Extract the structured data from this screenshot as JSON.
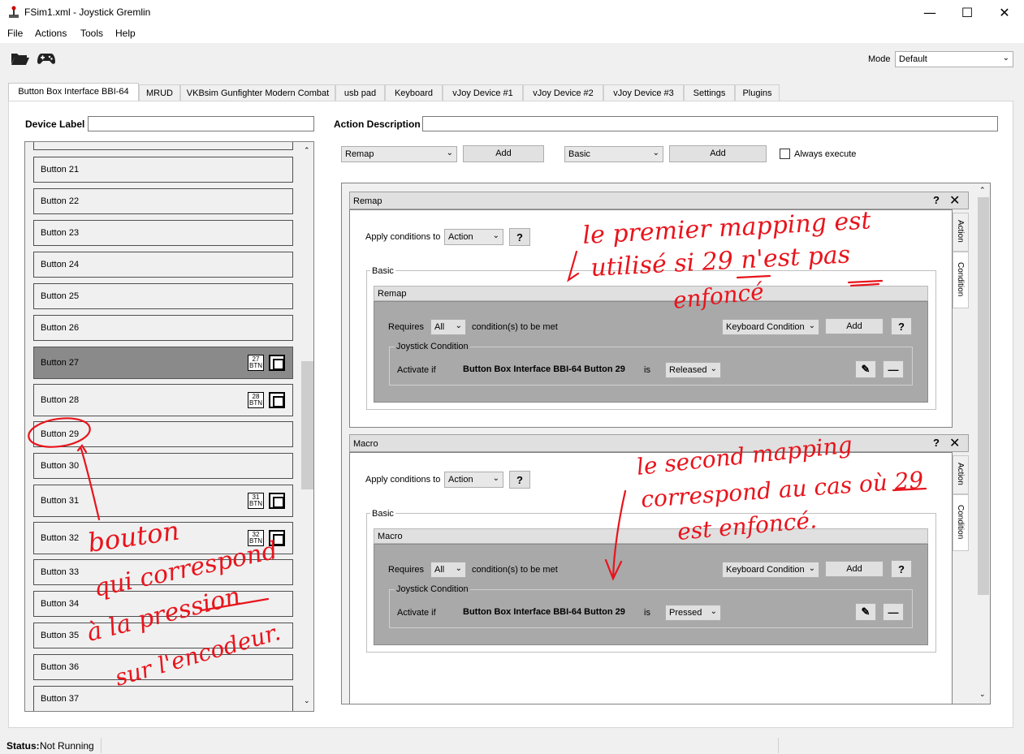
{
  "window": {
    "title": "FSim1.xml - Joystick Gremlin"
  },
  "menu": [
    "File",
    "Actions",
    "Tools",
    "Help"
  ],
  "toolbar": {
    "mode_label": "Mode",
    "mode_value": "Default"
  },
  "tabs": [
    "Button Box Interface BBI-64",
    "MRUD",
    "VKBsim Gunfighter Modern Combat",
    "usb pad",
    "Keyboard",
    "vJoy Device #1",
    "vJoy Device #2",
    "vJoy Device #3",
    "Settings",
    "Plugins"
  ],
  "left": {
    "device_label": "Device Label",
    "device_label_value": "",
    "buttons": [
      {
        "label": "Button 21",
        "badge": ""
      },
      {
        "label": "Button 22",
        "badge": ""
      },
      {
        "label": "Button 23",
        "badge": ""
      },
      {
        "label": "Button 24",
        "badge": ""
      },
      {
        "label": "Button 25",
        "badge": ""
      },
      {
        "label": "Button 26",
        "badge": ""
      },
      {
        "label": "Button 27",
        "badge": "27"
      },
      {
        "label": "Button 28",
        "badge": "28"
      },
      {
        "label": "Button 29",
        "badge": ""
      },
      {
        "label": "Button 30",
        "badge": ""
      },
      {
        "label": "Button 31",
        "badge": "31"
      },
      {
        "label": "Button 32",
        "badge": "32"
      },
      {
        "label": "Button 33",
        "badge": ""
      },
      {
        "label": "Button 34",
        "badge": ""
      },
      {
        "label": "Button 35",
        "badge": ""
      },
      {
        "label": "Button 36",
        "badge": ""
      },
      {
        "label": "Button 37",
        "badge": ""
      }
    ],
    "badge_sub": "BTN"
  },
  "right": {
    "action_description_label": "Action Description",
    "action_description_value": "",
    "action_combo": "Remap",
    "add_label": "Add",
    "container_combo": "Basic",
    "always_execute": "Always execute",
    "remap_panel": {
      "title": "Remap",
      "apply_label": "Apply conditions to",
      "apply_value": "Action",
      "help": "?",
      "basic_label": "Basic",
      "inner_header": "Remap",
      "requires": "Requires",
      "requires_value": "All",
      "conditions_met": "condition(s) to be met",
      "cond_type": "Keyboard Condition",
      "add": "Add",
      "joy_cond_label": "Joystick Condition",
      "activate_if": "Activate if",
      "input_name": "Button Box Interface BBI-64 Button 29",
      "is": "is",
      "state": "Released",
      "side_tabs": [
        "Action",
        "Condition"
      ]
    },
    "macro_panel": {
      "title": "Macro",
      "apply_label": "Apply conditions to",
      "apply_value": "Action",
      "help": "?",
      "basic_label": "Basic",
      "inner_header": "Macro",
      "requires": "Requires",
      "requires_value": "All",
      "conditions_met": "condition(s) to be met",
      "cond_type": "Keyboard Condition",
      "add": "Add",
      "joy_cond_label": "Joystick Condition",
      "activate_if": "Activate if",
      "input_name": "Button Box Interface BBI-64 Button 29",
      "is": "is",
      "state": "Pressed",
      "side_tabs": [
        "Action",
        "Condition"
      ]
    }
  },
  "status": {
    "label": "Status:",
    "value": "Not Running"
  },
  "annotations": {
    "note1_line1": "le premier mapping est",
    "note1_line2": "utilisé si 29 n'est pas",
    "note1_line3": "enfoncé",
    "note2_line1": "le second mapping",
    "note2_line2": "correspond au cas où 29",
    "note2_line3": "est enfoncé.",
    "note3_line1": "bouton",
    "note3_line2": "qui correspond",
    "note3_line3": "à la pression",
    "note3_line4": "sur l'encodeur."
  },
  "colors": {
    "annotation": "#e8141c",
    "selected_row": "#8a8a8a",
    "gray_box": "#a9a9a9"
  }
}
